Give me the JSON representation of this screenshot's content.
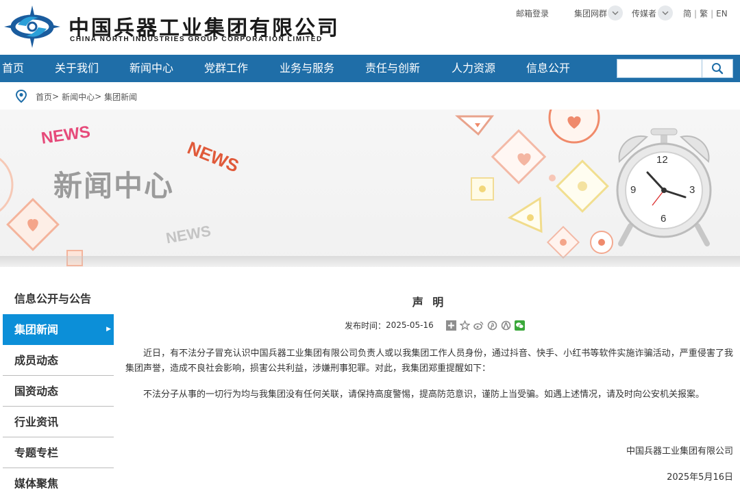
{
  "header": {
    "brand_cn": "中国兵器工业集团有限公司",
    "brand_en": "CHINA NORTH INDUSTRIES GROUP CORPORATION LIMITED",
    "links": {
      "mail_login": "邮箱登录",
      "group_network": "集团网群",
      "media": "传媒者"
    },
    "lang": {
      "simplified": "简",
      "traditional": "繁",
      "english": "EN"
    }
  },
  "nav": {
    "items": [
      "首页",
      "关于我们",
      "新闻中心",
      "党群工作",
      "业务与服务",
      "责任与创新",
      "人力资源",
      "信息公开"
    ],
    "search_value": "",
    "icon": "search-icon"
  },
  "breadcrumb": {
    "home": "首页",
    "section": "新闻中心",
    "current": "集团新闻",
    "separator": ">"
  },
  "banner": {
    "title": "新闻中心",
    "news_words": [
      "NEWS",
      "NEWS",
      "NEWS"
    ],
    "clock_numbers": [
      "12",
      "3",
      "6",
      "9"
    ]
  },
  "sidebar": {
    "heading": "信息公开与公告",
    "items": [
      "集团新闻",
      "成员动态",
      "国资动态",
      "行业资讯",
      "专题专栏",
      "媒体聚焦"
    ],
    "active": "集团新闻"
  },
  "article": {
    "title": "声 明",
    "publish_label": "发布时间：",
    "publish_date": "2025-05-16",
    "share_icons": [
      "plus-icon",
      "favorite-icon",
      "weibo-icon",
      "pinterest-icon",
      "renren-icon",
      "wechat-icon"
    ],
    "paragraph1": "近日，有不法分子冒充认识中国兵器工业集团有限公司负责人或以我集团工作人员身份，通过抖音、快手、小红书等软件实施诈骗活动，严重侵害了我集团声誉，造成不良社会影响，损害公共利益，涉嫌刑事犯罪。对此，我集团郑重提醒如下：",
    "paragraph2": "不法分子从事的一切行为均与我集团没有任何关联，请保持高度警惕，提高防范意识，谨防上当受骗。如遇上述情况，请及时向公安机关报案。",
    "signature": "中国兵器工业集团有限公司",
    "date": "2025年5月16日"
  },
  "colors": {
    "nav_bg": "#1f6ea8",
    "active_bg": "#0c8fd8",
    "logo_blue": "#1a5c9e",
    "banner_accent": "#f08a6a"
  }
}
